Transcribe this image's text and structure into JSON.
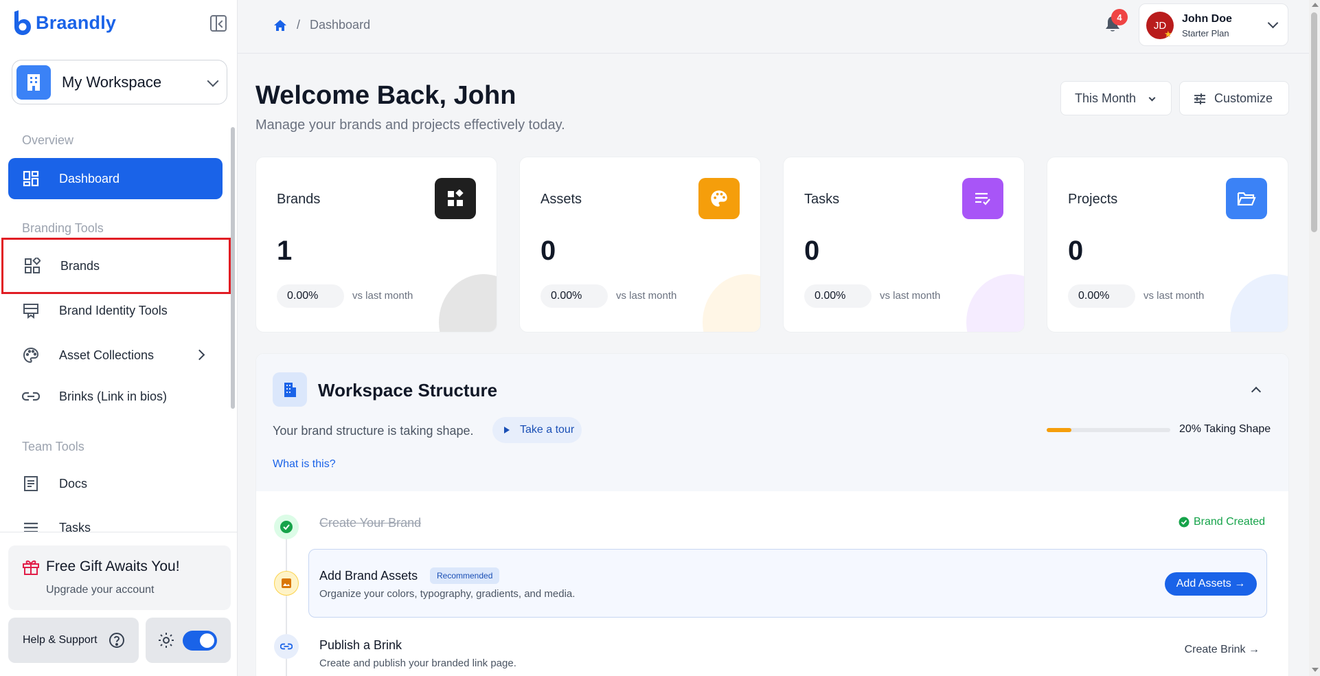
{
  "sidebar": {
    "logo_text": "Braandly",
    "workspace_label": "My Workspace",
    "sections": {
      "overview": "Overview",
      "branding_tools": "Branding Tools",
      "team_tools": "Team Tools"
    },
    "items": {
      "dashboard": "Dashboard",
      "brands": "Brands",
      "brand_identity_tools": "Brand Identity Tools",
      "asset_collections": "Asset Collections",
      "brinks": "Brinks (Link in bios)",
      "docs": "Docs",
      "tasks": "Tasks"
    },
    "gift": {
      "title": "Free Gift Awaits You!",
      "subtitle": "Upgrade your account"
    },
    "help_label": "Help & Support"
  },
  "header": {
    "breadcrumb_current": "Dashboard",
    "notification_count": "4",
    "user": {
      "initials": "JD",
      "name": "John Doe",
      "plan": "Starter Plan"
    }
  },
  "main": {
    "title": "Welcome Back, John",
    "subtitle": "Manage your brands and projects effectively today.",
    "period_button": "This Month",
    "customize_button": "Customize",
    "stats": [
      {
        "label": "Brands",
        "value": "1",
        "change": "0.00%",
        "compare": "vs last month"
      },
      {
        "label": "Assets",
        "value": "0",
        "change": "0.00%",
        "compare": "vs last month"
      },
      {
        "label": "Tasks",
        "value": "0",
        "change": "0.00%",
        "compare": "vs last month"
      },
      {
        "label": "Projects",
        "value": "0",
        "change": "0.00%",
        "compare": "vs last month"
      }
    ],
    "workspace_structure": {
      "title": "Workspace Structure",
      "description": "Your brand structure is taking shape.",
      "tour_button": "Take a tour",
      "what_link": "What is this?",
      "progress_percent": 20,
      "progress_label": "20% Taking Shape",
      "steps": {
        "create_brand": {
          "title": "Create Your Brand",
          "status": "Brand Created"
        },
        "add_assets": {
          "title": "Add Brand Assets",
          "badge": "Recommended",
          "description": "Organize your colors, typography, gradients, and media.",
          "action": "Add Assets →"
        },
        "publish_brink": {
          "title": "Publish a Brink",
          "description": "Create and publish your branded link page.",
          "action": "Create Brink →"
        }
      }
    }
  },
  "colors": {
    "brand_blue": "#1a63e8",
    "brands_icon": "#1f1f1f",
    "assets_icon": "#f59e0b",
    "tasks_icon": "#a855f7",
    "projects_icon": "#3b82f6",
    "highlight_border": "#e11d24"
  }
}
